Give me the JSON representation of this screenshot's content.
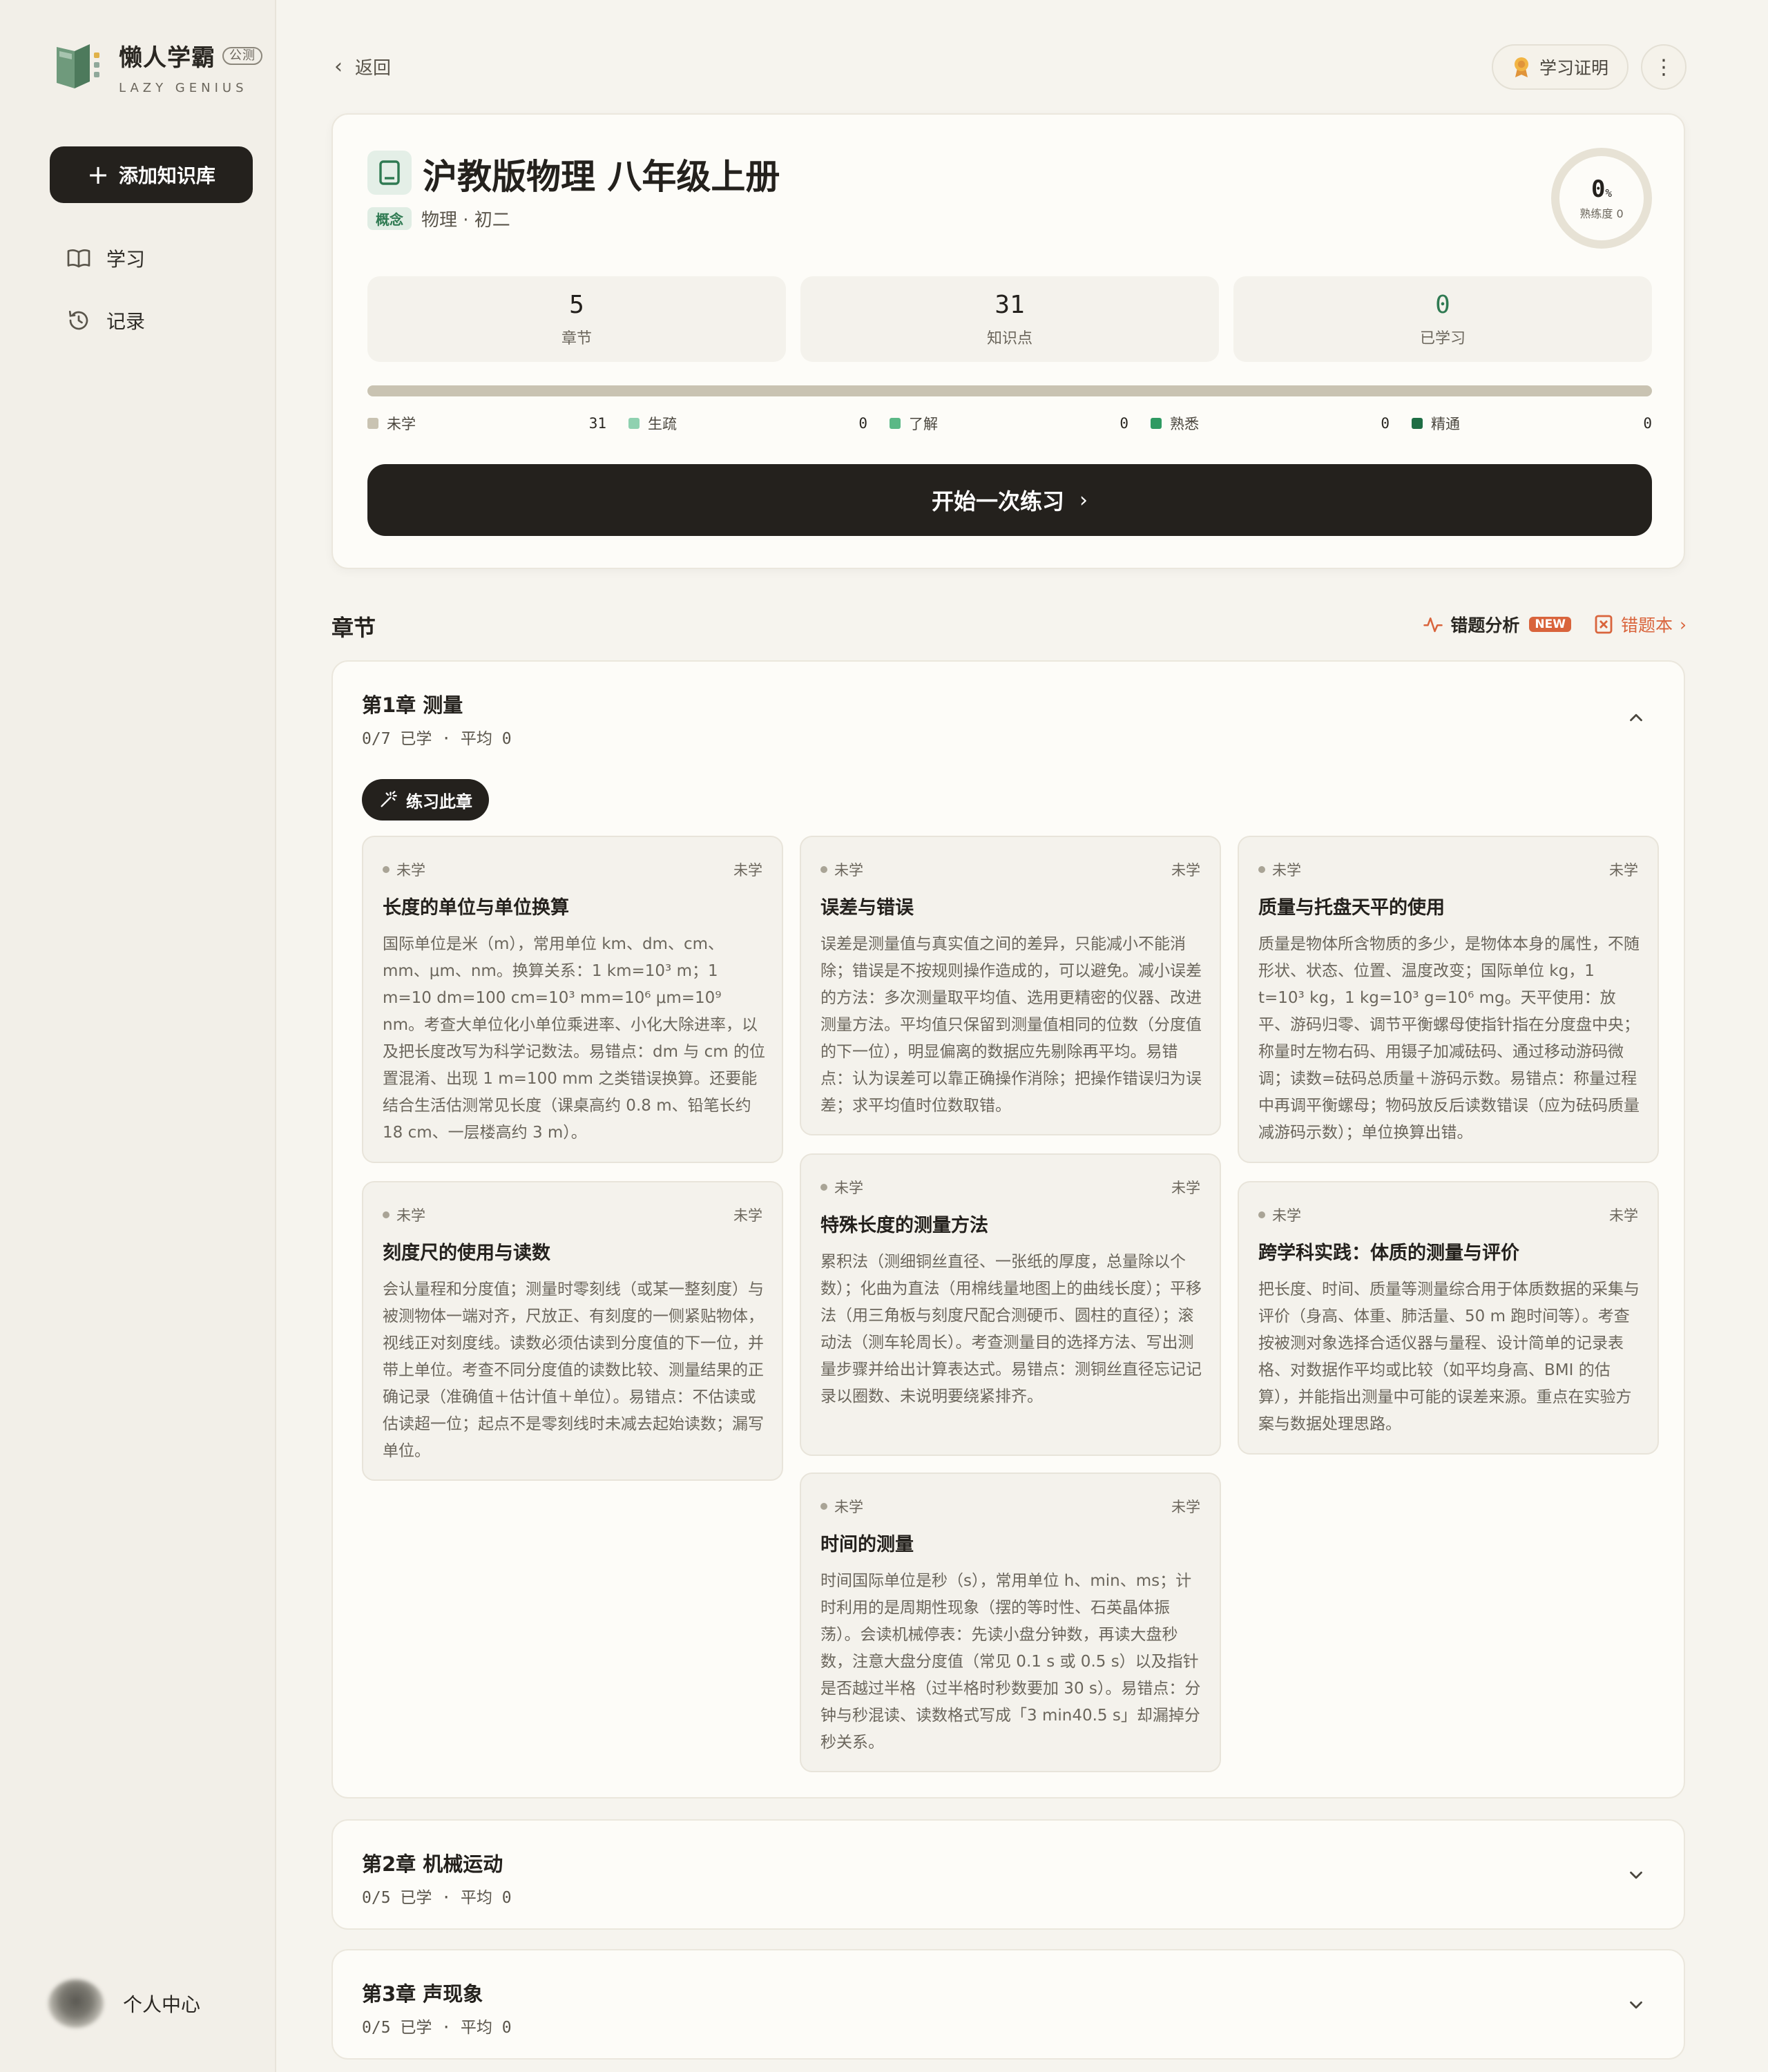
{
  "brand": {
    "name": "懒人学霸",
    "tag": "公测",
    "subtitle": "LAZY GENIUS"
  },
  "sidebar": {
    "add_label": "添加知识库",
    "nav": [
      {
        "label": "学习",
        "icon": "book-open-icon"
      },
      {
        "label": "记录",
        "icon": "history-icon"
      }
    ],
    "profile_label": "个人中心"
  },
  "topbar": {
    "back_label": "返回",
    "cert_label": "学习证明"
  },
  "overview": {
    "title": "沪教版物理 八年级上册",
    "tag": "概念",
    "meta": "物理 · 初二",
    "mastery_value": "0",
    "mastery_unit": "%",
    "mastery_label": "熟练度 0",
    "stats": [
      {
        "value": "5",
        "label": "章节"
      },
      {
        "value": "31",
        "label": "知识点"
      },
      {
        "value": "0",
        "label": "已学习"
      }
    ],
    "legend": [
      {
        "label": "未学",
        "count": "31",
        "color": "#c9c3b2"
      },
      {
        "label": "生疏",
        "count": "0",
        "color": "#8fd1b0"
      },
      {
        "label": "了解",
        "count": "0",
        "color": "#5bb886"
      },
      {
        "label": "熟悉",
        "count": "0",
        "color": "#2f9a62"
      },
      {
        "label": "精通",
        "count": "0",
        "color": "#1f6e45"
      }
    ],
    "start_label": "开始一次练习"
  },
  "chapters_section": {
    "title": "章节",
    "error_analysis_label": "错题分析",
    "new_badge": "NEW",
    "error_book_label": "错题本"
  },
  "chapters": [
    {
      "title": "第1章 测量",
      "meta": "0/7 已学 · 平均 0",
      "practice_label": "练习此章",
      "points": [
        {
          "status": "未学",
          "level": "未学",
          "title": "长度的单位与单位换算",
          "desc": "国际单位是米（m），常用单位 km、dm、cm、mm、μm、nm。换算关系：1 km=10³ m；1 m=10 dm=100 cm=10³ mm=10⁶ μm=10⁹ nm。考查大单位化小单位乘进率、小化大除进率，以及把长度改写为科学记数法。易错点：dm 与 cm 的位置混淆、出现 1 m=100 mm 之类错误换算。还要能结合生活估测常见长度（课桌高约 0.8 m、铅笔长约 18 cm、一层楼高约 3 m）。"
        },
        {
          "status": "未学",
          "level": "未学",
          "title": "误差与错误",
          "desc": "误差是测量值与真实值之间的差异，只能减小不能消除；错误是不按规则操作造成的，可以避免。减小误差的方法：多次测量取平均值、选用更精密的仪器、改进测量方法。平均值只保留到测量值相同的位数（分度值的下一位），明显偏离的数据应先剔除再平均。易错点：认为误差可以靠正确操作消除；把操作错误归为误差；求平均值时位数取错。"
        },
        {
          "status": "未学",
          "level": "未学",
          "title": "质量与托盘天平的使用",
          "desc": "质量是物体所含物质的多少，是物体本身的属性，不随形状、状态、位置、温度改变；国际单位 kg，1 t=10³ kg，1 kg=10³ g=10⁶ mg。天平使用：放平、游码归零、调节平衡螺母使指针指在分度盘中央；称量时左物右码、用镊子加减砝码、通过移动游码微调；读数=砝码总质量＋游码示数。易错点：称量过程中再调平衡螺母；物码放反后读数错误（应为砝码质量减游码示数）；单位换算出错。"
        },
        {
          "status": "未学",
          "level": "未学",
          "title": "刻度尺的使用与读数",
          "desc": "会认量程和分度值；测量时零刻线（或某一整刻度）与被测物体一端对齐，尺放正、有刻度的一侧紧贴物体，视线正对刻度线。读数必须估读到分度值的下一位，并带上单位。考查不同分度值的读数比较、测量结果的正确记录（准确值＋估计值＋单位）。易错点：不估读或估读超一位；起点不是零刻线时未减去起始读数；漏写单位。"
        },
        {
          "status": "未学",
          "level": "未学",
          "title": "特殊长度的测量方法",
          "desc": "累积法（测细铜丝直径、一张纸的厚度，总量除以个数）；化曲为直法（用棉线量地图上的曲线长度）；平移法（用三角板与刻度尺配合测硬币、圆柱的直径）；滚动法（测车轮周长）。考查测量目的选择方法、写出测量步骤并给出计算表达式。易错点：测铜丝直径忘记记录以圈数、未说明要绕紧排齐。"
        },
        {
          "status": "未学",
          "level": "未学",
          "title": "跨学科实践：体质的测量与评价",
          "desc": "把长度、时间、质量等测量综合用于体质数据的采集与评价（身高、体重、肺活量、50 m 跑时间等）。考查按被测对象选择合适仪器与量程、设计简单的记录表格、对数据作平均或比较（如平均身高、BMI 的估算），并能指出测量中可能的误差来源。重点在实验方案与数据处理思路。"
        },
        {
          "status": "未学",
          "level": "未学",
          "title": "时间的测量",
          "desc": "时间国际单位是秒（s），常用单位 h、min、ms；计时利用的是周期性现象（摆的等时性、石英晶体振荡）。会读机械停表：先读小盘分钟数，再读大盘秒数，注意大盘分度值（常见 0.1 s 或 0.5 s）以及指针是否越过半格（过半格时秒数要加 30 s）。易错点：分钟与秒混读、读数格式写成「3 min40.5 s」却漏掉分秒关系。"
        }
      ]
    },
    {
      "title": "第2章 机械运动",
      "meta": "0/5 已学 · 平均 0"
    },
    {
      "title": "第3章 声现象",
      "meta": "0/5 已学 · 平均 0"
    }
  ]
}
